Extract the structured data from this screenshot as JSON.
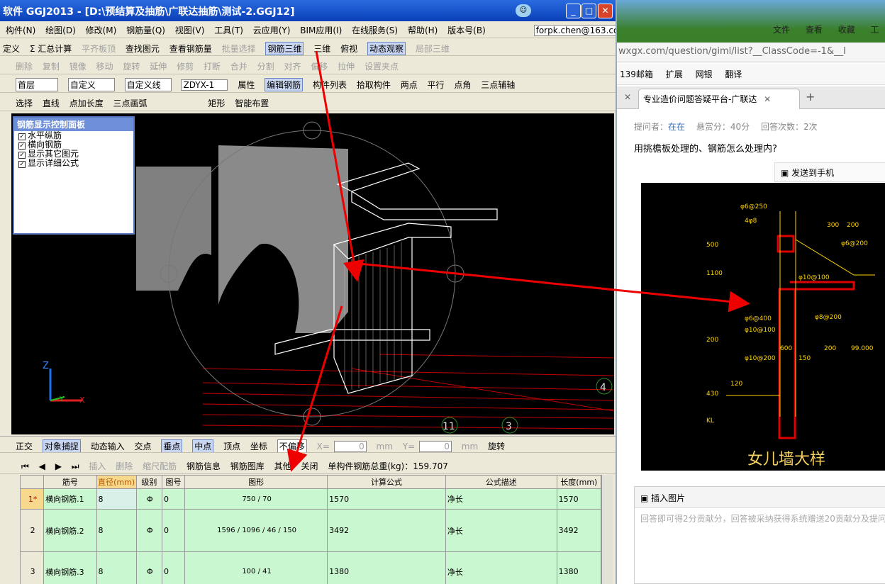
{
  "left_app": {
    "title": "软件 GGJ2013 - [D:\\预结算及抽筋\\广联达抽筋\\测试-2.GGJ12]",
    "menu": [
      "构件(N)",
      "绘图(D)",
      "修改(M)",
      "钢筋量(Q)",
      "视图(V)",
      "工具(T)",
      "云应用(Y)",
      "BIM应用(I)",
      "在线服务(S)",
      "帮助(H)",
      "版本号(B)"
    ],
    "user": "forpk.chen@163.com",
    "toolbar1": [
      "定义",
      "Σ 汇总计算",
      "平齐板顶",
      "查找图元",
      "查看钢筋量",
      "批量选择",
      "钢筋三维",
      "三维",
      "俯视",
      "动态观察",
      "局部三维"
    ],
    "toolbar2": [
      "删除",
      "复制",
      "镜像",
      "移动",
      "旋转",
      "延伸",
      "修剪",
      "打断",
      "合并",
      "分割",
      "对齐",
      "偏移",
      "拉伸",
      "设置夹点"
    ],
    "toolbar3": {
      "floor": "首层",
      "type": "自定义",
      "subtype": "自定义线",
      "code": "ZDYX-1",
      "items": [
        "属性",
        "编辑钢筋",
        "构件列表",
        "拾取构件",
        "两点",
        "平行",
        "点角",
        "三点辅轴"
      ]
    },
    "toolbar4": [
      "选择",
      "直线",
      "点加长度",
      "三点画弧",
      "矩形",
      "智能布置"
    ],
    "panel": {
      "title": "钢筋显示控制面板",
      "items": [
        "水平纵筋",
        "横向钢筋",
        "显示其它图元",
        "显示详细公式"
      ]
    },
    "axes": {
      "z": "Z",
      "y": "Y",
      "x": "X"
    },
    "grid_labels": [
      "4",
      "11",
      "3"
    ],
    "snap_bar": {
      "items": [
        "正交",
        "对象捕捉",
        "动态输入",
        "交点",
        "垂点",
        "中点",
        "顶点",
        "坐标"
      ],
      "offset": "不偏移",
      "x_label": "X=",
      "x_value": "0",
      "y_label": "Y=",
      "y_value": "0",
      "unit": "mm",
      "rotate": "旋转"
    },
    "table_bar": {
      "items": [
        "插入",
        "删除",
        "缩尺配筋",
        "钢筋信息",
        "钢筋图库",
        "其他",
        "关闭"
      ],
      "total": "单构件钢筋总重(kg)：159.707"
    },
    "table": {
      "headers": [
        "",
        "筋号",
        "直径(mm)",
        "级别",
        "图号",
        "图形",
        "计算公式",
        "公式描述",
        "长度(mm)"
      ],
      "rows": [
        {
          "num": "1*",
          "name": "横向钢筋.1",
          "dia": "8",
          "grade": "Φ",
          "fig": "0",
          "shape": "750 / 70",
          "formula": "1570",
          "desc": "净长",
          "len": "1570"
        },
        {
          "num": "2",
          "name": "横向钢筋.2",
          "dia": "8",
          "grade": "Φ",
          "fig": "0",
          "shape": "1596 / 1096 / 46 / 150",
          "formula": "3492",
          "desc": "净长",
          "len": "3492"
        },
        {
          "num": "3",
          "name": "横向钢筋.3",
          "dia": "8",
          "grade": "Φ",
          "fig": "0",
          "shape": "100 / 41",
          "formula": "1380",
          "desc": "净长",
          "len": "1380"
        }
      ]
    }
  },
  "right_app": {
    "menu": [
      "文件",
      "查看",
      "收藏",
      "工"
    ],
    "url": "wxgx.com/question/giml/list?__ClassCode=-1&__I",
    "favs": [
      "139邮箱",
      "扩展",
      "网银",
      "翻译"
    ],
    "tab_title": "专业造价问题答疑平台-广联达",
    "meta": {
      "asker_label": "提问者：",
      "asker": "在在",
      "reward": "悬赏分：40分",
      "answers": "回答次数：2次"
    },
    "question": "用挑檐板处理的、钢筋怎么处理内?",
    "send_phone": "发送到手机",
    "cad_caption": "女儿墙大样",
    "cad_labels": [
      "φ6@250",
      "4φ8",
      "φ6@200",
      "φ10@100",
      "φ8@200",
      "φ6@400",
      "φ10@100",
      "φ10@200",
      "150",
      "300",
      "200",
      "500",
      "1100",
      "200",
      "600",
      "200",
      "99.000",
      "120",
      "430",
      "KL"
    ],
    "insert_label": "插入图片",
    "insert_placeholder": "回答即可得2分贡献分，回答被采纳获得系统赠送20贡献分及提问"
  }
}
